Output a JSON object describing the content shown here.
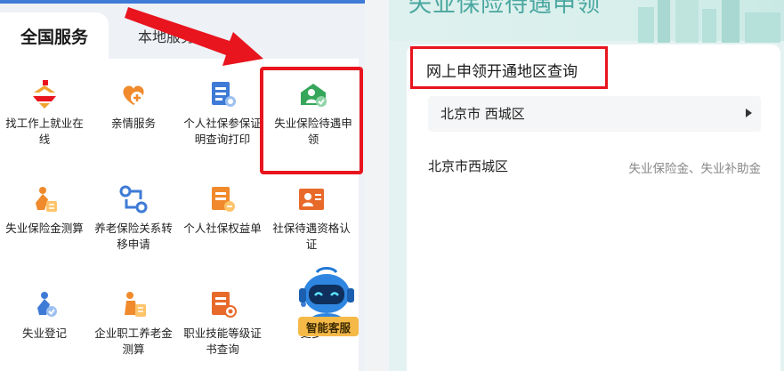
{
  "left_app": {
    "tabs": {
      "active": "全国服务",
      "inactive": "本地服务"
    },
    "services": [
      {
        "label": "找工作上就业在线",
        "icon": "job-search-icon",
        "color": "#e8a23a"
      },
      {
        "label": "亲情服务",
        "icon": "heart-hands-icon",
        "color": "#f08a2c"
      },
      {
        "label": "个人社保参保证明查询打印",
        "icon": "certificate-print-icon",
        "color": "#3e7bd6"
      },
      {
        "label": "失业保险待遇申领",
        "icon": "unemployment-claim-icon",
        "color": "#35a65a"
      },
      {
        "label": "失业保险金测算",
        "icon": "calculator-person-icon",
        "color": "#f08a2c"
      },
      {
        "label": "养老保险关系转移申请",
        "icon": "transfer-icon",
        "color": "#3e7bd6"
      },
      {
        "label": "个人社保权益单",
        "icon": "rights-document-icon",
        "color": "#f08a2c"
      },
      {
        "label": "社保待遇资格认证",
        "icon": "qualification-cert-icon",
        "color": "#e86a2a"
      },
      {
        "label": "失业登记",
        "icon": "register-person-icon",
        "color": "#3e7bd6"
      },
      {
        "label": "企业职工养老金测算",
        "icon": "pension-calc-icon",
        "color": "#f08a2c"
      },
      {
        "label": "职业技能等级证书查询",
        "icon": "skill-certificate-icon",
        "color": "#e86a2a"
      },
      {
        "label": "更多",
        "icon": "more-icon",
        "color": "#3e7bd6"
      }
    ],
    "robot_label": "智能客服"
  },
  "right_app": {
    "page_title": "失业保险待遇申领",
    "query_title": "网上申领开通地区查询",
    "region_select": "北京市 西城区",
    "result": {
      "region": "北京市西城区",
      "types": "失业保险金、失业补助金"
    }
  },
  "colors": {
    "highlight": "#e8141e",
    "accent_blue": "#3e7bd6",
    "accent_teal": "#4aa7a0"
  }
}
